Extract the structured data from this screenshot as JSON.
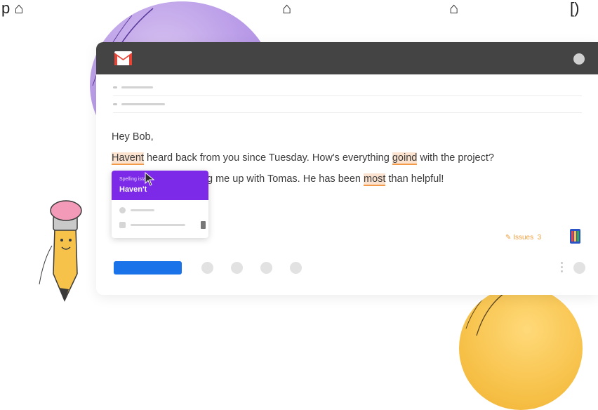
{
  "top_strip": {
    "left_text": "p ⌂",
    "middle_text": "⌂",
    "right_text": "⌂",
    "corner_text": "[)"
  },
  "email": {
    "greeting": "Hey Bob,",
    "line1": {
      "error_word": "Havent",
      "text_a": " heard back from you since Tuesday. How's everything ",
      "error_word_2": "goind",
      "text_b": " with the project?"
    },
    "line2": {
      "text_a": "g me up with Tomas. He has been ",
      "error_word": "most",
      "text_b": " than helpful!"
    }
  },
  "suggestion_card": {
    "category": "Spelling    istake",
    "suggestion": "Haven't"
  },
  "issues": {
    "label": "Issues",
    "count": "3",
    "color": "#f0a040"
  },
  "colors": {
    "titlebar": "#444444",
    "accent_purple": "#7d2ae8",
    "send_blue": "#1a73e8",
    "highlight": "#f29a4a"
  },
  "icons": {
    "logo": "gmail-icon",
    "pointer": "cursor-icon",
    "dictionary": "book-icon",
    "issues": "pen-icon"
  }
}
